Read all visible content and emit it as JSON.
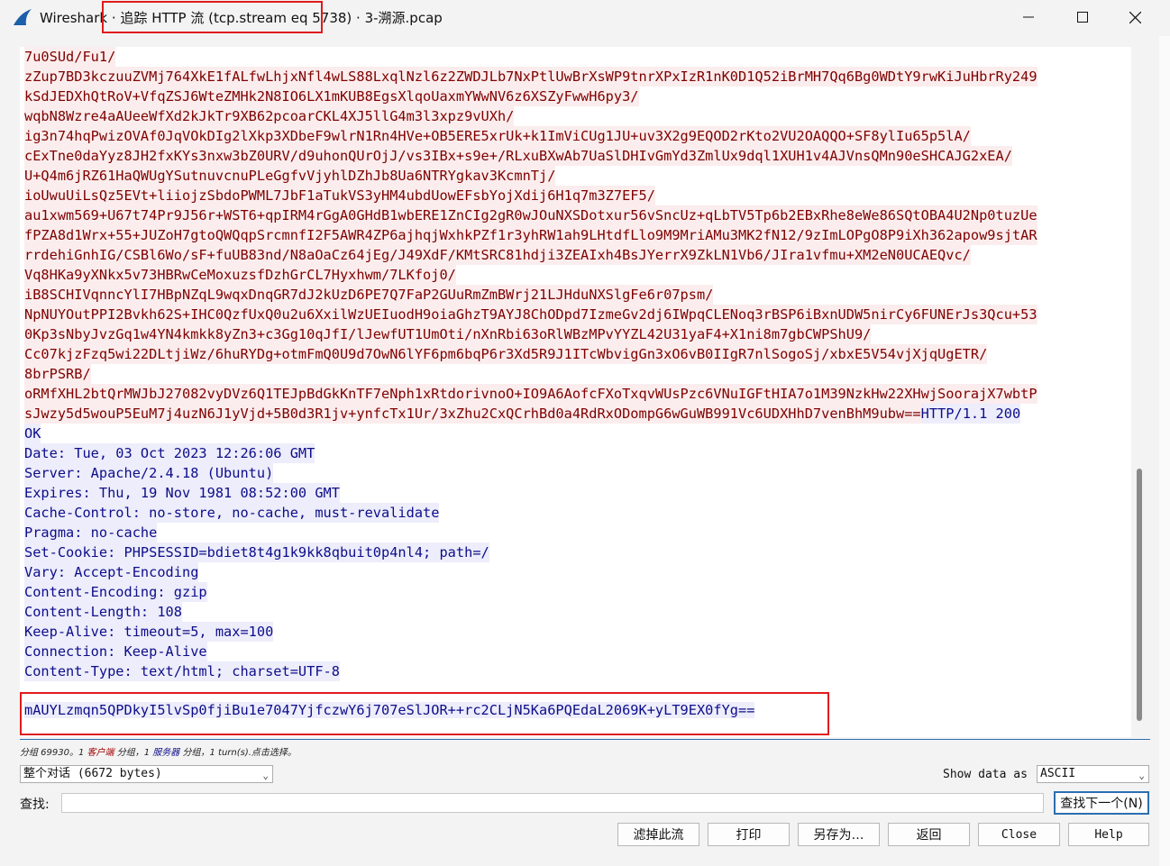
{
  "window": {
    "app_name": "Wireshark",
    "title_highlighted": "追踪 HTTP 流 (tcp.stream eq 5738)",
    "title_suffix": "3-溯源.pcap",
    "minimize_icon": "minimize-icon",
    "maximize_icon": "maximize-icon",
    "close_icon": "close-icon"
  },
  "stream": {
    "client_lines": [
      "7u0SUd/Fu1/",
      "zZup7BD3kczuuZVMj764XkE1fALfwLhjxNfl4wLS88LxqlNzl6z2ZWDJLb7NxPtlUwBrXsWP9tnrXPxIzR1nK0D1Q52iBrMH7Qq6Bg0WDtY9rwKiJuHbrRy249",
      "kSdJEDXhQtRoV+VfqZSJ6WteZMHk2N8IO6LX1mKUB8EgsXlqoUaxmYWwNV6z6XSZyFwwH6py3/",
      "wqbN8Wzre4aAUeeWfXd2kJkTr9XB62pcoarCKL4XJ5llG4m3l3xpz9vUXh/",
      "ig3n74hqPwizOVAf0JqVOkDIg2lXkp3XDbeF9wlrN1Rn4HVe+OB5ERE5xrUk+k1ImViCUg1JU+uv3X2g9EQOD2rKto2VU2OAQQO+SF8ylIu65p5lA/",
      "cExTne0daYyz8JH2fxKYs3nxw3bZ0URV/d9uhonQUrOjJ/vs3IBx+s9e+/RLxuBXwAb7UaSlDHIvGmYd3ZmlUx9dql1XUH1v4AJVnsQMn90eSHCAJG2xEA/",
      "U+Q4m6jRZ61HaQWUgYSutnuvcnuPLeGgfvVjyhlDZhJb8Ua6NTRYgkav3KcmnTj/",
      "ioUwuUiLsQz5EVt+liiojzSbdoPWML7JbF1aTukVS3yHM4ubdUowEFsbYojXdij6H1q7m3Z7EF5/",
      "au1xwm569+U67t74Pr9J56r+WST6+qpIRM4rGgA0GHdB1wbERE1ZnCIg2gR0wJOuNXSDotxur56vSncUz+qLbTV5Tp6b2EBxRhe8eWe86SQtOBA4U2Np0tuzUe",
      "fPZA8d1Wrx+55+JUZoH7gtoQWQqpSrcmnfI2F5AWR4ZP6ajhqjWxhkPZf1r3yhRW1ah9LHtdfLlo9M9MriAMu3MK2fN12/9zImLOPgO8P9iXh362apow9sjtAR",
      "rrdehiGnhIG/CSBl6Wo/sF+fuUB83nd/N8aOaCz64jEg/J49XdF/KMtSRC81hdji3ZEAIxh4BsJYerrX9ZkLN1Vb6/JIra1vfmu+XM2eN0UCAEQvc/",
      "Vq8HKa9yXNkx5v73HBRwCeMoxuzsfDzhGrCL7Hyxhwm/7LKfoj0/",
      "iB8SCHIVqnncYlI7HBpNZqL9wqxDnqGR7dJ2kUzD6PE7Q7FaP2GUuRmZmBWrj21LJHduNXSlgFe6r07psm/",
      "NpNUYOutPPI2Bvkh62S+IHC0QzfUxQ0u2u6XxilWzUEIuodH9oiaGhzT9AYJ8ChODpd7IzmeGv2dj6IWpqCLENoq3rBSP6iBxnUDW5nirCy6FUNErJs3Qcu+53",
      "0Kp3sNbyJvzGq1w4YN4kmkk8yZn3+c3Gg10qJfI/lJewfUT1UmOti/nXnRbi63oRlWBzMPvYYZL42U31yaF4+X1ni8m7gbCWPShU9/",
      "Cc07kjzFzq5wi22DLtjiWz/6huRYDg+otmFmQ0U9d7OwN6lYF6pm6bqP6r3Xd5R9J1ITcWbvigGn3xO6vB0IIgR7nlSogoSj/xbxE5V54vjXjqUgETR/",
      "8brPSRB/",
      "oRMfXHL2btQrMWJbJ27082vyDVz6Q1TEJpBdGkKnTF7eNph1xRtdorivnoO+IO9A6AofcFXoTxqvWUsPzc6VNuIGFtHIA7o1M39NzkHw22XHwjSoorajX7wbtP",
      "sJwzy5d5wouP5EuM7j4uzN6J1yVjd+5B0d3R1jv+ynfcTx1Ur/3xZhu2CxQCrhBd0a4RdRxODompG6wGuWB991Vc6UDXHhD7venBhM9ubw=="
    ],
    "server_inline": "HTTP/1.1 200",
    "server_lines": [
      "OK",
      "Date: Tue, 03 Oct 2023 12:26:06 GMT",
      "Server: Apache/2.4.18 (Ubuntu)",
      "Expires: Thu, 19 Nov 1981 08:52:00 GMT",
      "Cache-Control: no-store, no-cache, must-revalidate",
      "Pragma: no-cache",
      "Set-Cookie: PHPSESSID=bdiet8t4g1k9kk8qbuit0p4nl4; path=/",
      "Vary: Accept-Encoding",
      "Content-Encoding: gzip",
      "Content-Length: 108",
      "Keep-Alive: timeout=5, max=100",
      "Connection: Keep-Alive",
      "Content-Type: text/html; charset=UTF-8"
    ],
    "response_body": "mAUYLzmqn5QPDkyI5lvSp0fjiBu1e7047YjfczwY6j707eSlJOR++rc2CLjN5Ka6PQEdaL2069K+yLT9EX0fYg=="
  },
  "status": {
    "prefix": "分组 69930。1",
    "client_word": "客户端",
    "middle": "分组，1",
    "server_word": "服务器",
    "suffix": "分组，1 turn(s).点击选择。"
  },
  "controls": {
    "conversation_select": "整个对话 (6672 bytes)",
    "show_data_as_label": "Show data as",
    "show_data_as_value": "ASCII",
    "find_label": "查找:",
    "find_value": "",
    "find_next_button": "查找下一个(N)",
    "filter_out_button": "滤掉此流",
    "print_button": "打印",
    "save_as_button": "另存为…",
    "back_button": "返回",
    "close_button": "Close",
    "help_button": "Help"
  },
  "colors": {
    "client_text": "#7f0000",
    "client_bg": "#fbeded",
    "server_text": "#0d0d8a",
    "server_bg": "#ededfb",
    "highlight_box": "#e01b1b"
  }
}
